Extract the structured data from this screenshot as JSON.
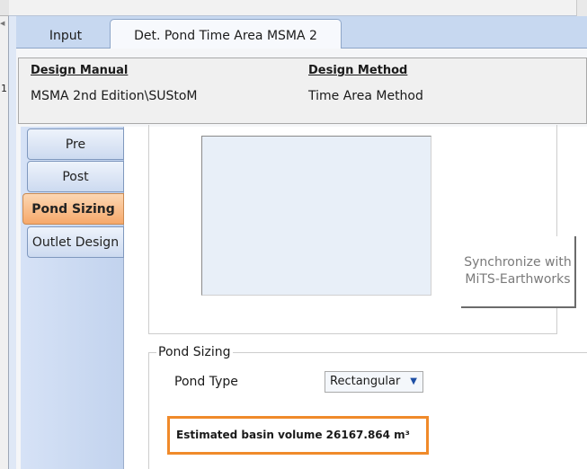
{
  "tabs": [
    {
      "label": "Input"
    },
    {
      "label": "Det. Pond Time Area MSMA 2",
      "active": true
    }
  ],
  "header": {
    "design_manual_label": "Design Manual",
    "design_manual_value": "MSMA 2nd Edition\\SUStoM",
    "design_method_label": "Design Method",
    "design_method_value": "Time Area Method"
  },
  "sidebar": {
    "items": [
      {
        "label": "Pre"
      },
      {
        "label": "Post"
      },
      {
        "label": "Pond Sizing",
        "active": true
      },
      {
        "label": "Outlet Design"
      }
    ]
  },
  "sync_button": {
    "line1": "Synchronize with",
    "line2": "MiTS-Earthworks"
  },
  "pond_sizing": {
    "title": "Pond Sizing",
    "pond_type_label": "Pond Type",
    "pond_type_value": "Rectangular",
    "estimated_volume_text": "Estimated basin volume 26167.864 m³"
  },
  "gutter": {
    "mark": "1"
  },
  "colors": {
    "active_tab_bg": "#f7f9fd",
    "tabbar_bg": "#c7d8f0",
    "active_side_btn": "#f6a86a",
    "highlight_border": "#f08a2a"
  }
}
